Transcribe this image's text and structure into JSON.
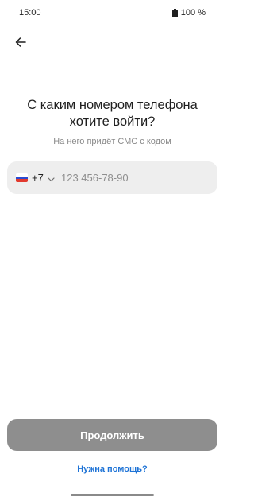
{
  "status_bar": {
    "time": "15:00",
    "battery": "100 %",
    "battery_icon": "battery-full-icon"
  },
  "nav": {
    "back_icon": "arrow-left-icon"
  },
  "main": {
    "title_line1": "С каким номером телефона",
    "title_line2": "хотите войти?",
    "subtitle": "На него придёт СМС с кодом"
  },
  "phone": {
    "flag_icon": "russia-flag-icon",
    "flag_colors": [
      "#ffffff",
      "#2b4bd1",
      "#e23a2e"
    ],
    "country_code": "+7",
    "chevron_icon": "chevron-down-icon",
    "placeholder": "123 456-78-90",
    "value": ""
  },
  "actions": {
    "continue_label": "Продолжить",
    "help_label": "Нужна помощь?"
  },
  "colors": {
    "accent_link": "#1e73d6",
    "button_disabled": "#8e8e8e",
    "field_background": "#eeeeee"
  }
}
